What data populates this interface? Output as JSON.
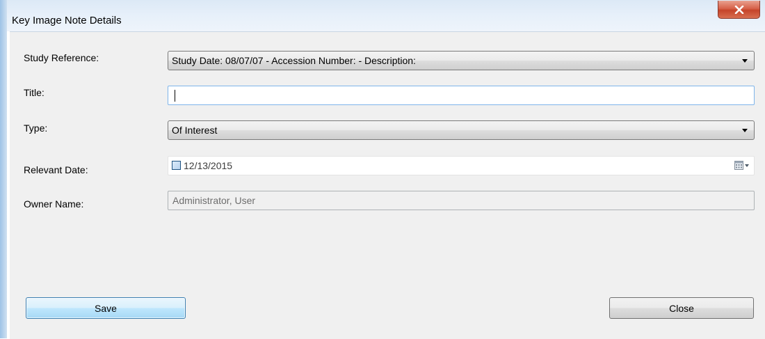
{
  "window": {
    "title": "Key Image Note Details",
    "close_icon": "close-x-icon"
  },
  "form": {
    "study_reference": {
      "label": "Study Reference:",
      "value": "Study Date: 08/07/07 - Accession Number:  - Description:"
    },
    "title": {
      "label": "Title:",
      "value": ""
    },
    "type": {
      "label": "Type:",
      "value": "Of Interest"
    },
    "relevant_date": {
      "label": "Relevant Date:",
      "checked": false,
      "value": "12/13/2015",
      "calendar_icon": "calendar-dropdown-icon"
    },
    "owner_name": {
      "label": "Owner Name:",
      "value": "Administrator, User"
    }
  },
  "buttons": {
    "save_label": "Save",
    "close_label": "Close"
  },
  "colors": {
    "title_bar": "#dce9f6",
    "close_button": "#c5442a",
    "client_background": "#f0f0f0",
    "save_button": "#bee6fd",
    "focus_border": "#7eb4ea"
  }
}
